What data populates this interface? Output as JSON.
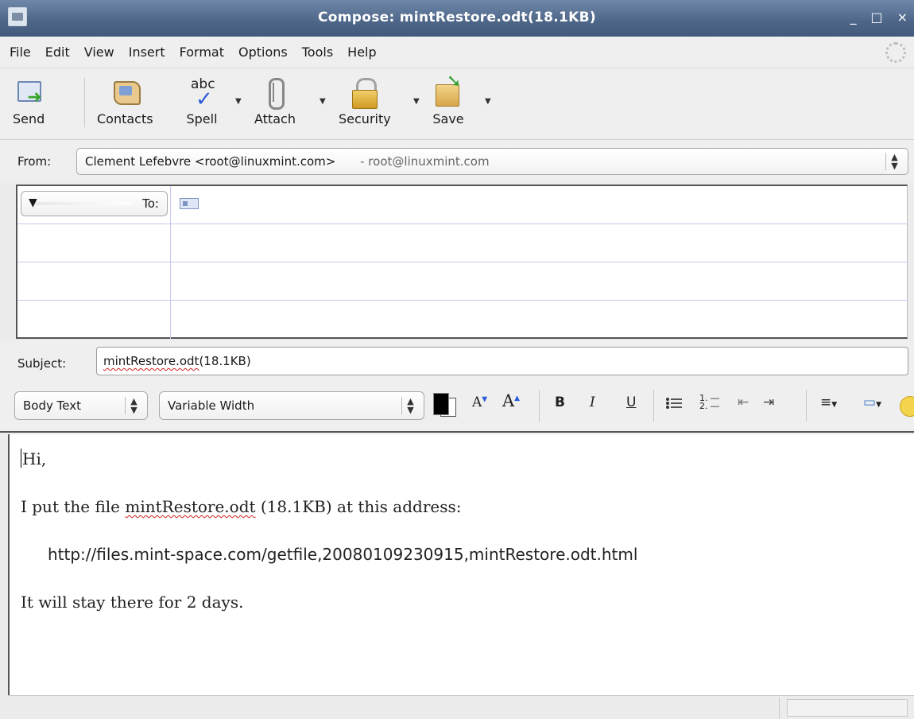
{
  "window": {
    "title": "Compose: mintRestore.odt(18.1KB)",
    "controls": {
      "minimize": "_",
      "maximize": "□",
      "close": "×"
    }
  },
  "menu": {
    "items": [
      "File",
      "Edit",
      "View",
      "Insert",
      "Format",
      "Options",
      "Tools",
      "Help"
    ]
  },
  "toolbar": {
    "send": "Send",
    "contacts": "Contacts",
    "spell": "Spell",
    "spell_icon_text": "abc",
    "attach": "Attach",
    "security": "Security",
    "save": "Save"
  },
  "from": {
    "label": "From:",
    "identity": "Clement Lefebvre <root@linuxmint.com>",
    "account": "- root@linuxmint.com"
  },
  "recipients": {
    "type_label": "To:",
    "rows": [
      "",
      "",
      "",
      ""
    ]
  },
  "subject": {
    "label": "Subject:",
    "value_spelled": "mintRestore.odt",
    "value_rest": "(18.1KB)"
  },
  "format_toolbar": {
    "paragraph_style": "Body Text",
    "font": "Variable Width",
    "smaller": "A",
    "larger": "A",
    "bold": "B",
    "italic": "I",
    "underline": "U",
    "numbered_list": "1.",
    "text_color": "#000000"
  },
  "message": {
    "greeting": "Hi,",
    "line1_a": "I put the file ",
    "line1_file": "mintRestore.odt",
    "line1_b": " (18.1KB) at this address:",
    "link": "http://files.mint-space.com/getfile,20080109230915,mintRestore.odt.html",
    "line3": "It will stay there for 2 days."
  }
}
